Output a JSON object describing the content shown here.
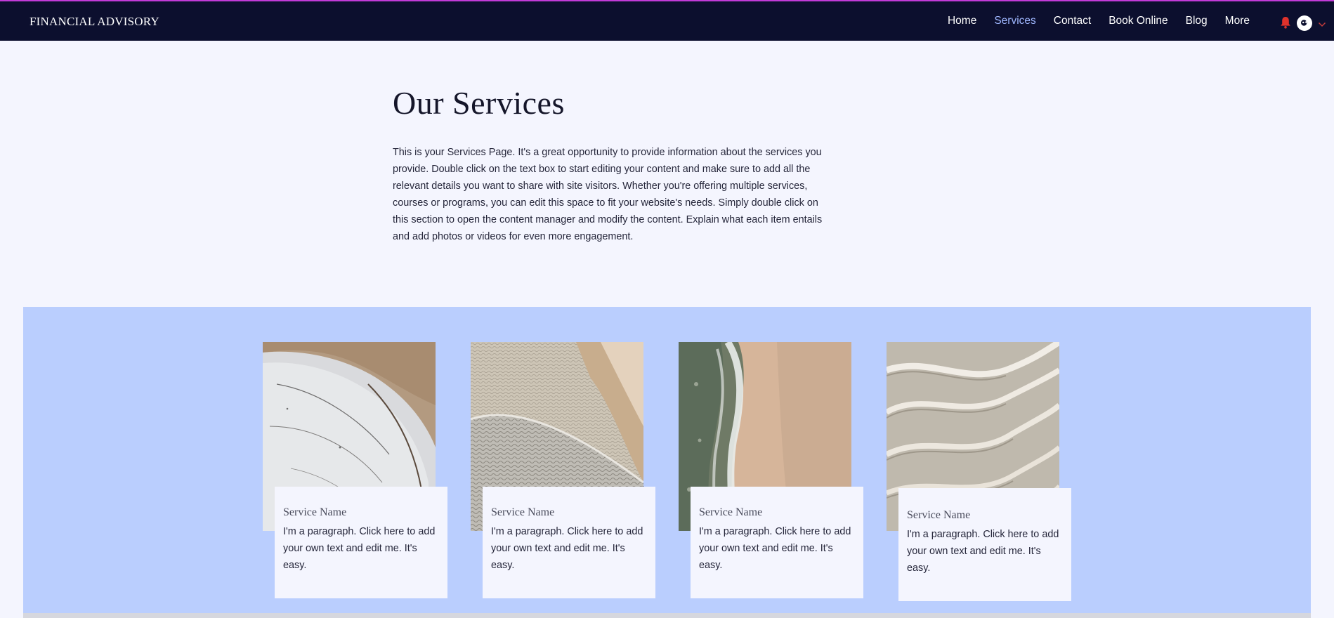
{
  "header": {
    "brand": "FINANCIAL ADVISORY",
    "nav": [
      {
        "label": "Home",
        "active": false
      },
      {
        "label": "Services",
        "active": true
      },
      {
        "label": "Contact",
        "active": false
      },
      {
        "label": "Book Online",
        "active": false
      },
      {
        "label": "Blog",
        "active": false
      },
      {
        "label": "More",
        "active": false
      }
    ],
    "icons": {
      "notification": "bell-icon",
      "avatar": "avatar-icon",
      "menu": "chevron-down-icon"
    },
    "colors": {
      "background": "#0c0f2e",
      "accent_line": "#c23bd8",
      "active_link": "#9fb7ff",
      "bell": "#e0322c"
    }
  },
  "intro": {
    "title": "Our Services",
    "text": "This is your Services Page. It's a great opportunity to provide information about the services you provide. Double click on the text box to start editing your content and make sure to add all the relevant details you want to share with site visitors. Whether you're offering multiple services, courses or programs, you can edit this space to fit your website's needs. Simply double click on this section to open the content manager and modify the content. Explain what each item entails and add photos or videos for even more engagement."
  },
  "services": {
    "background": "#bacefe",
    "cards": [
      {
        "title": "Service Name",
        "text": "I'm a paragraph. Click here to add your own text and edit me. It's easy.",
        "image": "aerial-shore-ice-image"
      },
      {
        "title": "Service Name",
        "text": "I'm a paragraph. Click here to add your own text and edit me. It's easy.",
        "image": "sand-ripples-dune-image"
      },
      {
        "title": "Service Name",
        "text": "I'm a paragraph. Click here to add your own text and edit me. It's easy.",
        "image": "ocean-wave-beach-image"
      },
      {
        "title": "Service Name",
        "text": "I'm a paragraph. Click here to add your own text and edit me. It's easy.",
        "image": "sand-dune-waves-image"
      }
    ]
  }
}
